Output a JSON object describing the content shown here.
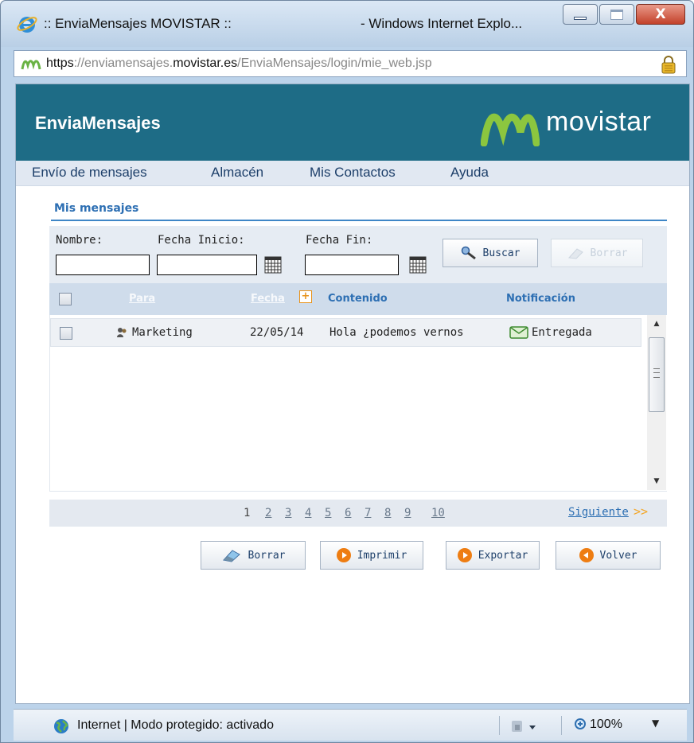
{
  "window": {
    "title_left": ":: EnviaMensajes MOVISTAR ::",
    "title_right": "- Windows Internet Explo...",
    "close_glyph": "X"
  },
  "address": {
    "scheme": "https",
    "host_prefix": "://enviamensajes.",
    "host_domain": "movistar.es",
    "path": "/EnviaMensajes/login/mie_web.jsp"
  },
  "header": {
    "brand": "EnviaMensajes",
    "logo_text": "movistar",
    "colors": {
      "header_bg": "#1e6c86",
      "logo_green": "#8cc63f"
    }
  },
  "menu": {
    "items": [
      {
        "label": "Envío de mensajes"
      },
      {
        "label": "Almacén"
      },
      {
        "label": "Mis Contactos"
      },
      {
        "label": "Ayuda"
      }
    ]
  },
  "section": {
    "title": "Mis mensajes"
  },
  "filters": {
    "nombre_label": "Nombre:",
    "fecha_inicio_label": "Fecha Inicio:",
    "fecha_fin_label": "Fecha Fin:",
    "nombre_value": "",
    "fecha_inicio_value": "",
    "fecha_fin_value": "",
    "buscar_label": "Buscar",
    "borrar_label": "Borrar"
  },
  "table": {
    "columns": {
      "para": "Para",
      "fecha": "Fecha",
      "contenido": "Contenido",
      "notificacion": "Notificación"
    },
    "sort_glyph": "+",
    "rows": [
      {
        "para": "Marketing",
        "fecha": "22/05/14",
        "contenido": "Hola ¿podemos vernos",
        "notificacion": "Entregada"
      }
    ]
  },
  "pager": {
    "current": "1",
    "pages": [
      "2",
      "3",
      "4",
      "5",
      "6",
      "7",
      "8",
      "9",
      "10"
    ],
    "next_label": "Siguiente",
    "next_arrows": ">>"
  },
  "actions": {
    "borrar": "Borrar",
    "imprimir": "Imprimir",
    "exportar": "Exportar",
    "volver": "Volver"
  },
  "status": {
    "text": "Internet | Modo protegido: activado",
    "zoom": "100%"
  }
}
